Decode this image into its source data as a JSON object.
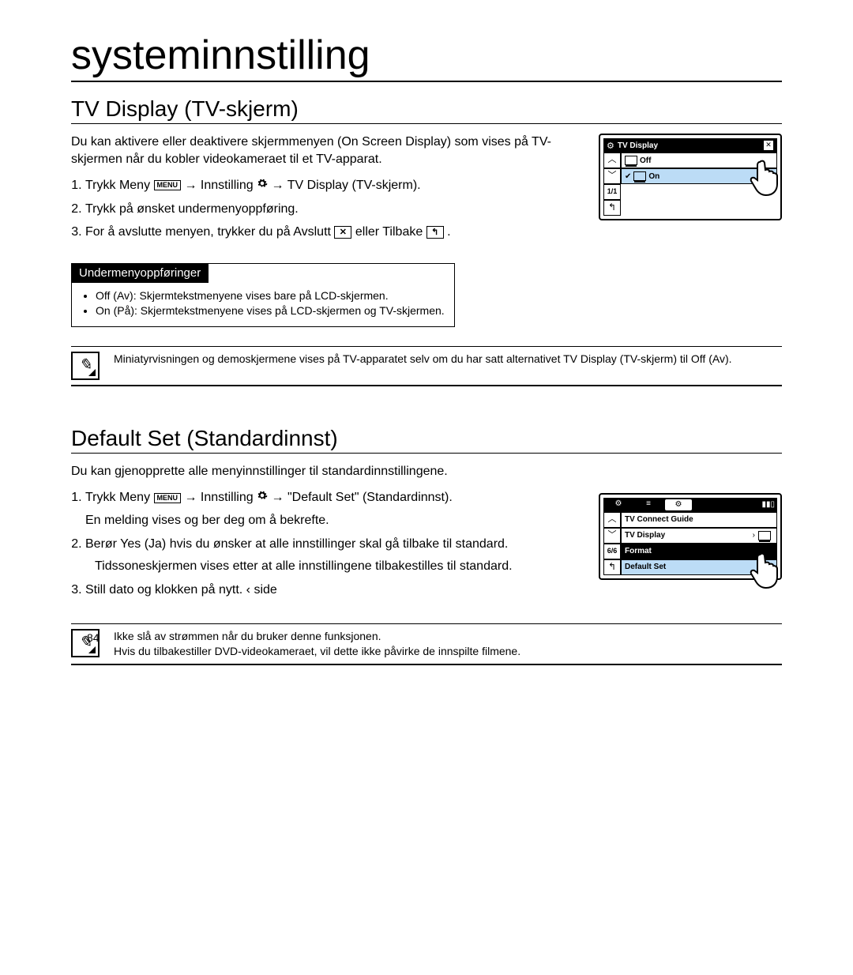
{
  "page_title": "systeminnstilling",
  "page_number": "84",
  "section1": {
    "title": "TV Display (TV-skjerm)",
    "intro": "Du kan aktivere eller deaktivere skjermmenyen (On Screen Display) som vises på TV-skjermen når du kobler videokameraet til et TV-apparat.",
    "step1_a": "Trykk Meny ",
    "step1_b": " → Innstilling ",
    "step1_c": " → TV Display (TV-skjerm).",
    "step2": "Trykk på ønsket undermenyoppføring.",
    "step3_a": "For å avslutte menyen, trykker du på Avslutt ",
    "step3_b": " eller Tilbake ",
    "step3_c": ".",
    "submenu_header": "Undermenyoppføringer",
    "submenu_off": "Off (Av): Skjermtekstmenyene vises bare på LCD-skjermen.",
    "submenu_on": "On (På): Skjermtekstmenyene vises på LCD-skjermen og TV-skjermen.",
    "note": "Miniatyrvisningen og demoskjermene vises på TV-apparatet selv om du har satt alternativet TV Display (TV-skjerm) til Off (Av).",
    "screen": {
      "title": "TV Display",
      "row_off": "Off",
      "row_on": "On",
      "counter": "1/1"
    }
  },
  "section2": {
    "title": "Default Set (Standardinnst)",
    "intro": "Du kan gjenopprette alle menyinnstillinger til standardinnstillingene.",
    "step1_a": "Trykk Meny ",
    "step1_b": " → Innstilling ",
    "step1_c": " → \"Default Set\" (Standardinnst).",
    "step1_note": "En melding vises og ber deg om å bekrefte.",
    "step2_a": "Berør Yes (Ja) hvis du ønsker at alle innstillinger skal gå tilbake til standard.",
    "step2_b": "Tidssoneskjermen vises etter at alle innstillingene tilbakestilles til standard.",
    "step3": "Still dato og klokken på nytt.   ‹ side",
    "note1": "Ikke slå av strømmen når du bruker denne funksjonen.",
    "note2": "Hvis du tilbakestiller DVD-videokameraet, vil dette ikke påvirke de innspilte filmene.",
    "screen": {
      "row1": "TV Connect Guide",
      "row2": "TV Display",
      "row3": "Format",
      "row4": "Default Set",
      "counter": "6/6"
    }
  }
}
